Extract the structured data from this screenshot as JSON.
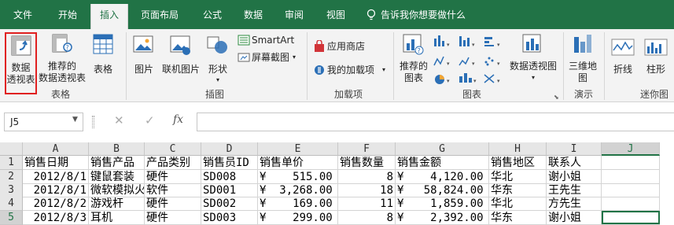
{
  "tabs": [
    {
      "label": "文件"
    },
    {
      "label": "开始"
    },
    {
      "label": "插入"
    },
    {
      "label": "页面布局"
    },
    {
      "label": "公式"
    },
    {
      "label": "数据"
    },
    {
      "label": "审阅"
    },
    {
      "label": "视图"
    }
  ],
  "tell_me": "告诉我你想要做什么",
  "ribbon": {
    "pivot": "数据\n透视表",
    "rec_pivot": "推荐的\n数据透视表",
    "table": "表格",
    "picture": "图片",
    "online_picture": "联机图片",
    "shapes": "形状",
    "smartart": "SmartArt",
    "screenshot": "屏幕截图",
    "store": "应用商店",
    "my_addins": "我的加载项",
    "rec_charts": "推荐的\n图表",
    "pivot_chart": "数据透视图",
    "map3d": "三维地\n图",
    "line": "折线",
    "column": "柱形",
    "groups": {
      "tables": "表格",
      "illustrations": "插图",
      "addins": "加载项",
      "charts": "图表",
      "tours": "演示",
      "sparklines": "迷你图"
    }
  },
  "formula_bar": {
    "name_box": "J5",
    "fx": "fx",
    "value": ""
  },
  "columns": [
    "A",
    "B",
    "C",
    "D",
    "E",
    "F",
    "G",
    "H",
    "I",
    "J"
  ],
  "rows": [
    {
      "num": "1",
      "cells": [
        "销售日期",
        "销售产品",
        "产品类别",
        "销售员ID",
        "销售单价",
        "销售数量",
        "销售金额",
        "销售地区",
        "联系人",
        ""
      ]
    },
    {
      "num": "2",
      "cells": [
        "2012/8/1",
        "键鼠套装",
        "硬件",
        "SD008",
        "¥    515.00",
        "8",
        "¥    4,120.00",
        "华北",
        "谢小姐",
        ""
      ]
    },
    {
      "num": "3",
      "cells": [
        "2012/8/1",
        "微软模拟火",
        "软件",
        "SD001",
        "¥  3,268.00",
        "18",
        "¥   58,824.00",
        "华东",
        "王先生",
        ""
      ]
    },
    {
      "num": "4",
      "cells": [
        "2012/8/2",
        "游戏杆",
        "硬件",
        "SD002",
        "¥    169.00",
        "11",
        "¥    1,859.00",
        "华北",
        "方先生",
        ""
      ]
    },
    {
      "num": "5",
      "cells": [
        "2012/8/3",
        "耳机",
        "硬件",
        "SD003",
        "¥    299.00",
        "8",
        "¥    2,392.00",
        "华东",
        "谢小姐",
        ""
      ]
    }
  ],
  "colors": {
    "brand": "#217346",
    "highlight": "#e02020"
  }
}
